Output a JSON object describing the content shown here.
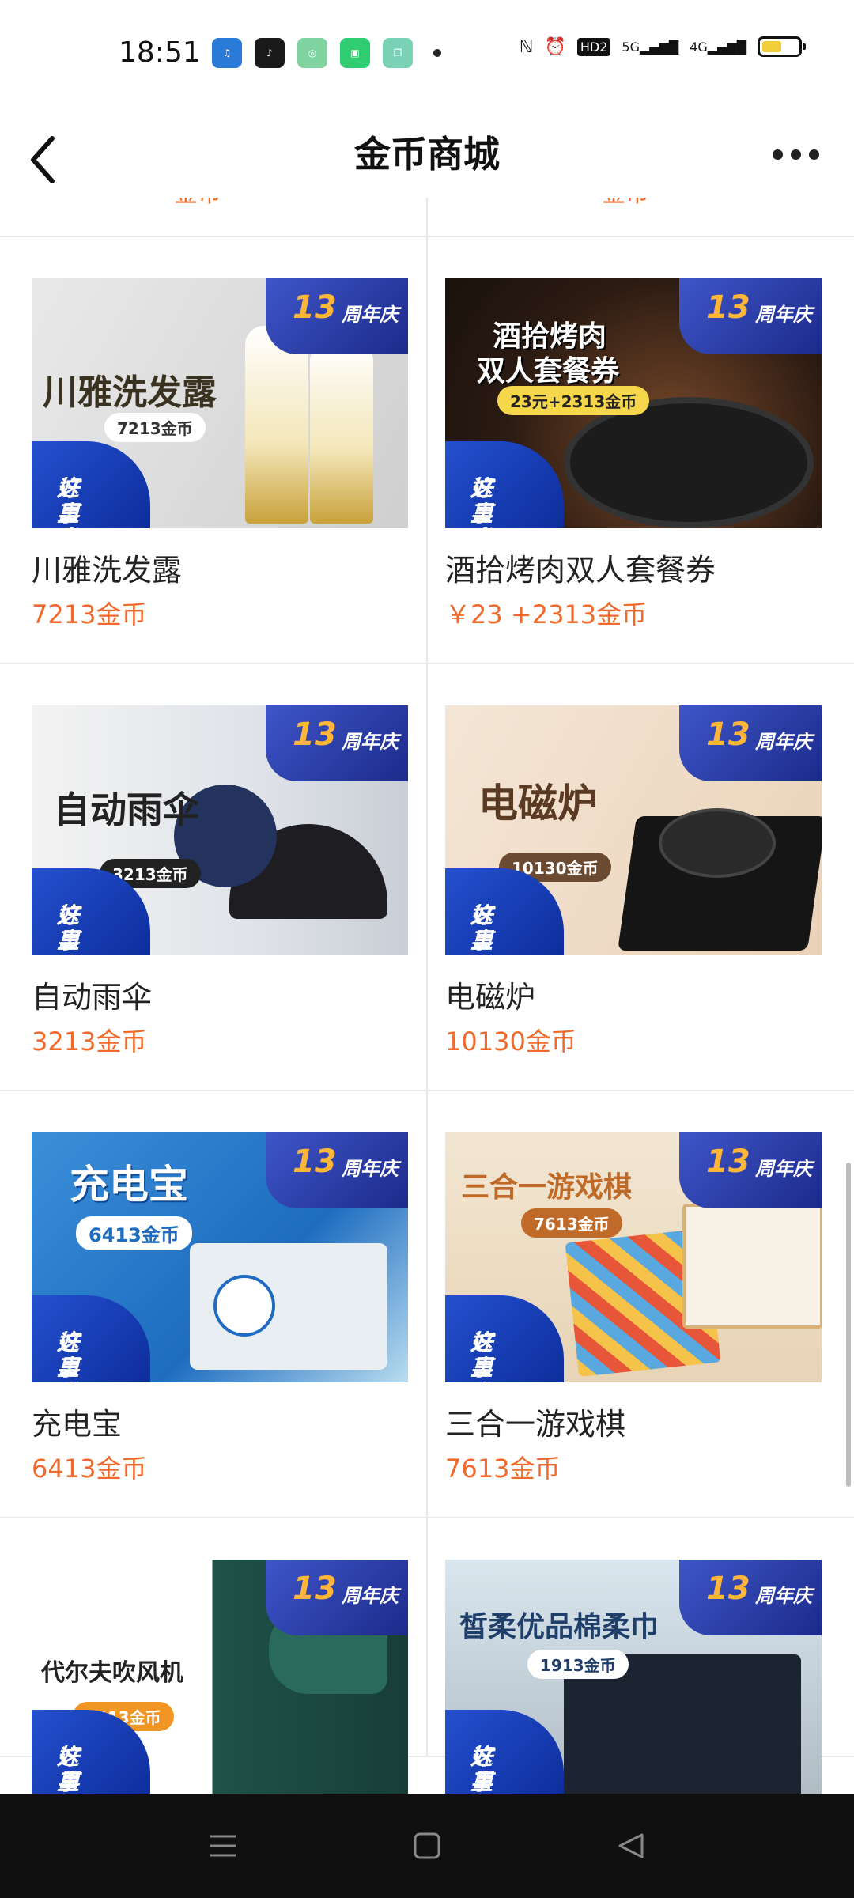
{
  "status_bar": {
    "time": "18:51",
    "app_icons": [
      "music-app-icon",
      "tiktok-icon",
      "camera-app-icon",
      "store-app-icon",
      "gallery-app-icon"
    ],
    "system_icons": [
      "nfc-icon",
      "alarm-icon",
      "hd-icon",
      "5g-signal-icon",
      "4g-signal-icon",
      "battery-icon"
    ],
    "hd_label": "HD2",
    "net1_label": "5G",
    "net2_label": "4G",
    "battery_level": 0.55
  },
  "header": {
    "title": "金币商城",
    "back_icon": "chevron-left-icon",
    "more_icon": "more-dots-icon"
  },
  "products": [
    {
      "name": "川雅洗发露",
      "price": "7213金币",
      "image": {
        "headline": "川雅洗发露",
        "pill": "7213金币"
      }
    },
    {
      "name": "酒拾烤肉双人套餐券",
      "price": "￥23 +2313金币",
      "image": {
        "headline_line1": "酒拾烤肉",
        "headline_line2": "双人套餐券",
        "pill": "23元+2313金币"
      }
    },
    {
      "name": "自动雨伞",
      "price": "3213金币",
      "image": {
        "headline": "自动雨伞",
        "pill": "3213金币"
      }
    },
    {
      "name": "电磁炉",
      "price": "10130金币",
      "image": {
        "headline": "电磁炉",
        "pill": "10130金币"
      }
    },
    {
      "name": "充电宝",
      "price": "6413金币",
      "image": {
        "headline": "充电宝",
        "pill": "6413金币"
      }
    },
    {
      "name": "三合一游戏棋",
      "price": "7613金币",
      "image": {
        "headline": "三合一游戏棋",
        "pill": "7613金币"
      }
    },
    {
      "name": "",
      "price": "",
      "image": {
        "headline": "代尔夫吹风机",
        "pill": "6013金币"
      }
    },
    {
      "name": "",
      "price": "",
      "image": {
        "headline": "皙柔优品棉柔巾",
        "pill": "1913金币"
      }
    }
  ],
  "image_badge": {
    "number": "13",
    "text": "周年庆"
  },
  "image_promo": {
    "line1": "好事在",
    "line2": "这里发生"
  },
  "peek_prices": [
    "金币",
    "金币"
  ],
  "nav_bar": {
    "icons": [
      "menu-icon",
      "home-square-icon",
      "back-triangle-icon"
    ]
  }
}
